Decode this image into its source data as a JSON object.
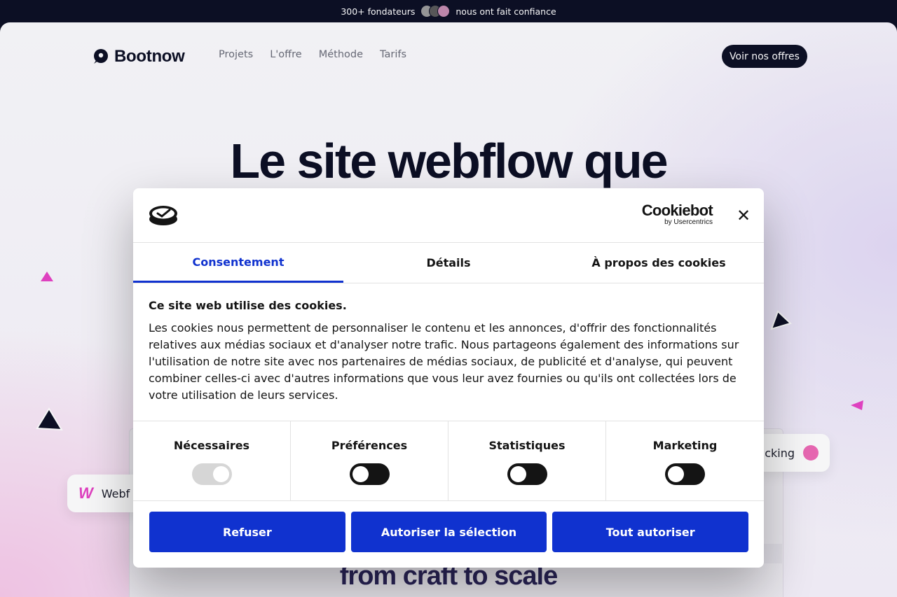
{
  "announcement": {
    "before": "300+ fondateurs",
    "after": "nous ont fait confiance"
  },
  "nav": {
    "brand": "Bootnow",
    "items": [
      "Projets",
      "L'offre",
      "Méthode",
      "Tarifs"
    ],
    "cta": "Voir nos offres"
  },
  "hero": {
    "title": "Le site webflow que",
    "bottom_text": "from craft to scale",
    "chip_left": "Webf",
    "chip_right": "cking"
  },
  "cookie_dialog": {
    "brand_main": "Cookiebot",
    "brand_sub": "by Usercentrics",
    "tabs": [
      "Consentement",
      "Détails",
      "À propos des cookies"
    ],
    "active_tab": 0,
    "title": "Ce site web utilise des cookies.",
    "text": "Les cookies nous permettent de personnaliser le contenu et les annonces, d'offrir des fonctionnalités relatives aux médias sociaux et d'analyser notre trafic. Nous partageons également des informations sur l'utilisation de notre site avec nos partenaires de médias sociaux, de publicité et d'analyse, qui peuvent combiner celles-ci avec d'autres informations que vous leur avez fournies ou qu'ils ont collectées lors de votre utilisation de leurs services.",
    "toggles": [
      {
        "label": "Nécessaires",
        "on": true,
        "disabled": true
      },
      {
        "label": "Préférences",
        "on": false
      },
      {
        "label": "Statistiques",
        "on": false
      },
      {
        "label": "Marketing",
        "on": false
      }
    ],
    "buttons": {
      "deny": "Refuser",
      "allow_selection": "Autoriser la sélection",
      "allow_all": "Tout autoriser"
    }
  },
  "colors": {
    "accent": "#1032cf",
    "dark": "#0c0f24",
    "pink": "#e743c5"
  }
}
